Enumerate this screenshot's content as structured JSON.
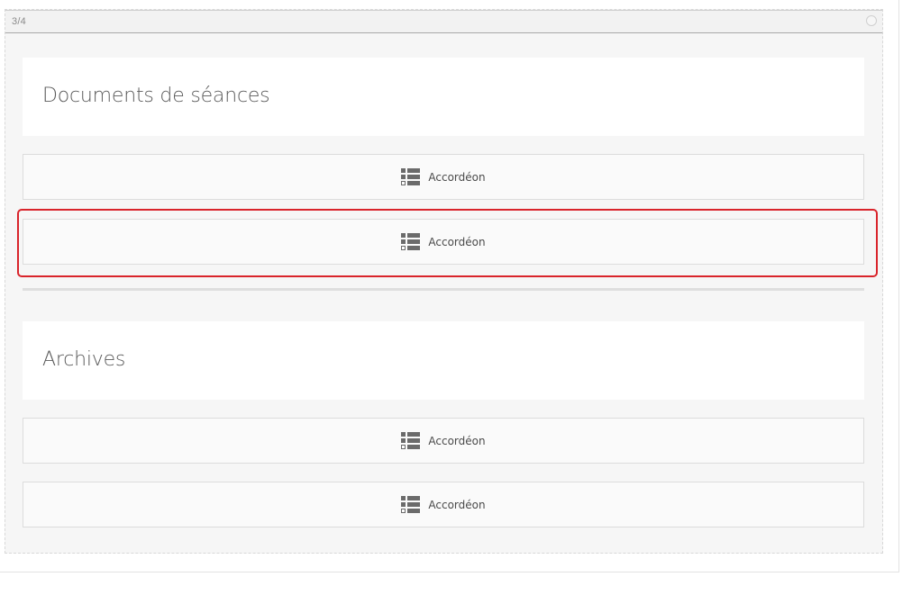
{
  "column": {
    "counter": "3/4"
  },
  "sections": [
    {
      "heading": "Documents de séances",
      "widgets": [
        {
          "label": "Accordéon",
          "icon": "accordion-icon",
          "selected": false
        },
        {
          "label": "Accordéon",
          "icon": "accordion-icon",
          "selected": true
        }
      ]
    },
    {
      "heading": "Archives",
      "widgets": [
        {
          "label": "Accordéon",
          "icon": "accordion-icon",
          "selected": false
        },
        {
          "label": "Accordéon",
          "icon": "accordion-icon",
          "selected": false
        }
      ]
    }
  ],
  "colors": {
    "selection": "#d9242b",
    "column_background": "#f6f6f6",
    "icon": "#6b6b6b"
  }
}
